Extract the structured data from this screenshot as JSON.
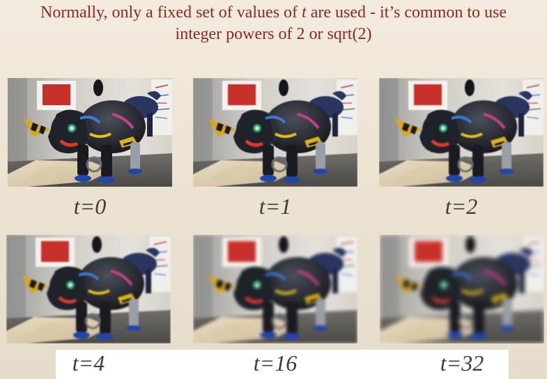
{
  "slide": {
    "title_line1_a": "Normally, only a fixed set of values of ",
    "title_var": "t",
    "title_line1_b": " are used - it’s common to use",
    "title_line2": "integer powers of 2 or sqrt(2)"
  },
  "panels": [
    {
      "label": "t=0",
      "blur": 0
    },
    {
      "label": "t=1",
      "blur": 1
    },
    {
      "label": "t=2",
      "blur": 2
    },
    {
      "label": "t=4",
      "blur": 4
    },
    {
      "label": "t=16",
      "blur": 16
    },
    {
      "label": "t=32",
      "blur": 32
    }
  ]
}
